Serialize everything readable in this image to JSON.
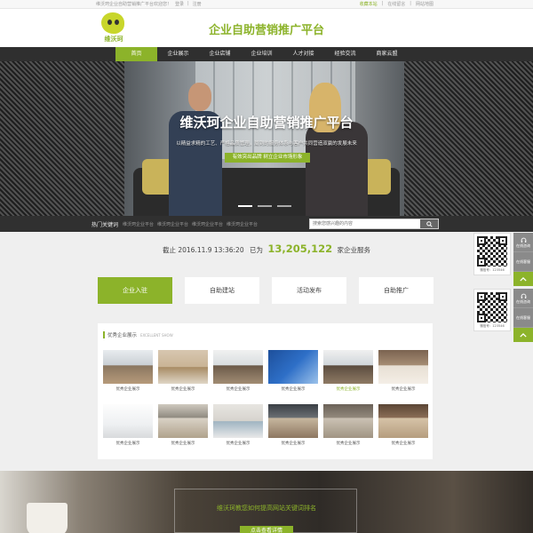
{
  "topbar": {
    "welcome": "维沃珂企业自助营销推广平台欢迎您！",
    "login": "登录",
    "register": "注册",
    "right_links": [
      "收藏本站",
      "在线留言",
      "网站地图"
    ]
  },
  "header": {
    "logo_text": "维沃珂",
    "slogan": "企业自助营销推广平台"
  },
  "nav": {
    "items": [
      "首页",
      "企业展示",
      "企业店铺",
      "企业培训",
      "人才对接",
      "经验交流",
      "商家云盟"
    ]
  },
  "banner": {
    "title": "维沃珂企业自助营销推广平台",
    "subtitle": "以精益求精的工艺、严格品质管理，周到的服务体系与客户共同营造双赢的发展未来",
    "cta": "有效突出品牌 树立企业市场形象",
    "slide_count": 3,
    "active_slide": 1
  },
  "keywords": {
    "label": "热门关键词",
    "items": [
      "维沃珂企业平台",
      "维沃珂企业平台",
      "维沃珂企业平台",
      "维沃珂企业平台"
    ],
    "search_placeholder": "搜索您感兴趣的内容"
  },
  "stats": {
    "prefix": "截止",
    "date": "2016.11.9",
    "time": "13:36:20",
    "mid": "已为",
    "count": "13,205,122",
    "suffix": "家企业服务"
  },
  "actions": [
    "企业入驻",
    "自助建站",
    "活动发布",
    "自助推广"
  ],
  "showcase": {
    "title": "优秀企业展示",
    "title_en": "EXCELLENT SHOW",
    "items": [
      {
        "caption": "优秀企业展示"
      },
      {
        "caption": "优秀企业展示"
      },
      {
        "caption": "优秀企业展示"
      },
      {
        "caption": "优秀企业展示"
      },
      {
        "caption": "优秀企业展示"
      },
      {
        "caption": "优秀企业展示"
      },
      {
        "caption": "优秀企业展示"
      },
      {
        "caption": "优秀企业展示"
      },
      {
        "caption": "优秀企业展示"
      },
      {
        "caption": "优秀企业展示"
      },
      {
        "caption": "优秀企业展示"
      },
      {
        "caption": "优秀企业展示"
      }
    ]
  },
  "bottom": {
    "message": "维沃珂教您如何提高网站关键词排名",
    "more": "点击查看详情"
  },
  "side": {
    "qr_caption": "微信号：123546",
    "items_top": [
      "在线咨询",
      "在线客服"
    ],
    "items_bottom": [
      "在线咨询",
      "在线客服"
    ]
  },
  "colors": {
    "accent": "#8cb32a",
    "nav_bg": "#2f2f2f"
  }
}
